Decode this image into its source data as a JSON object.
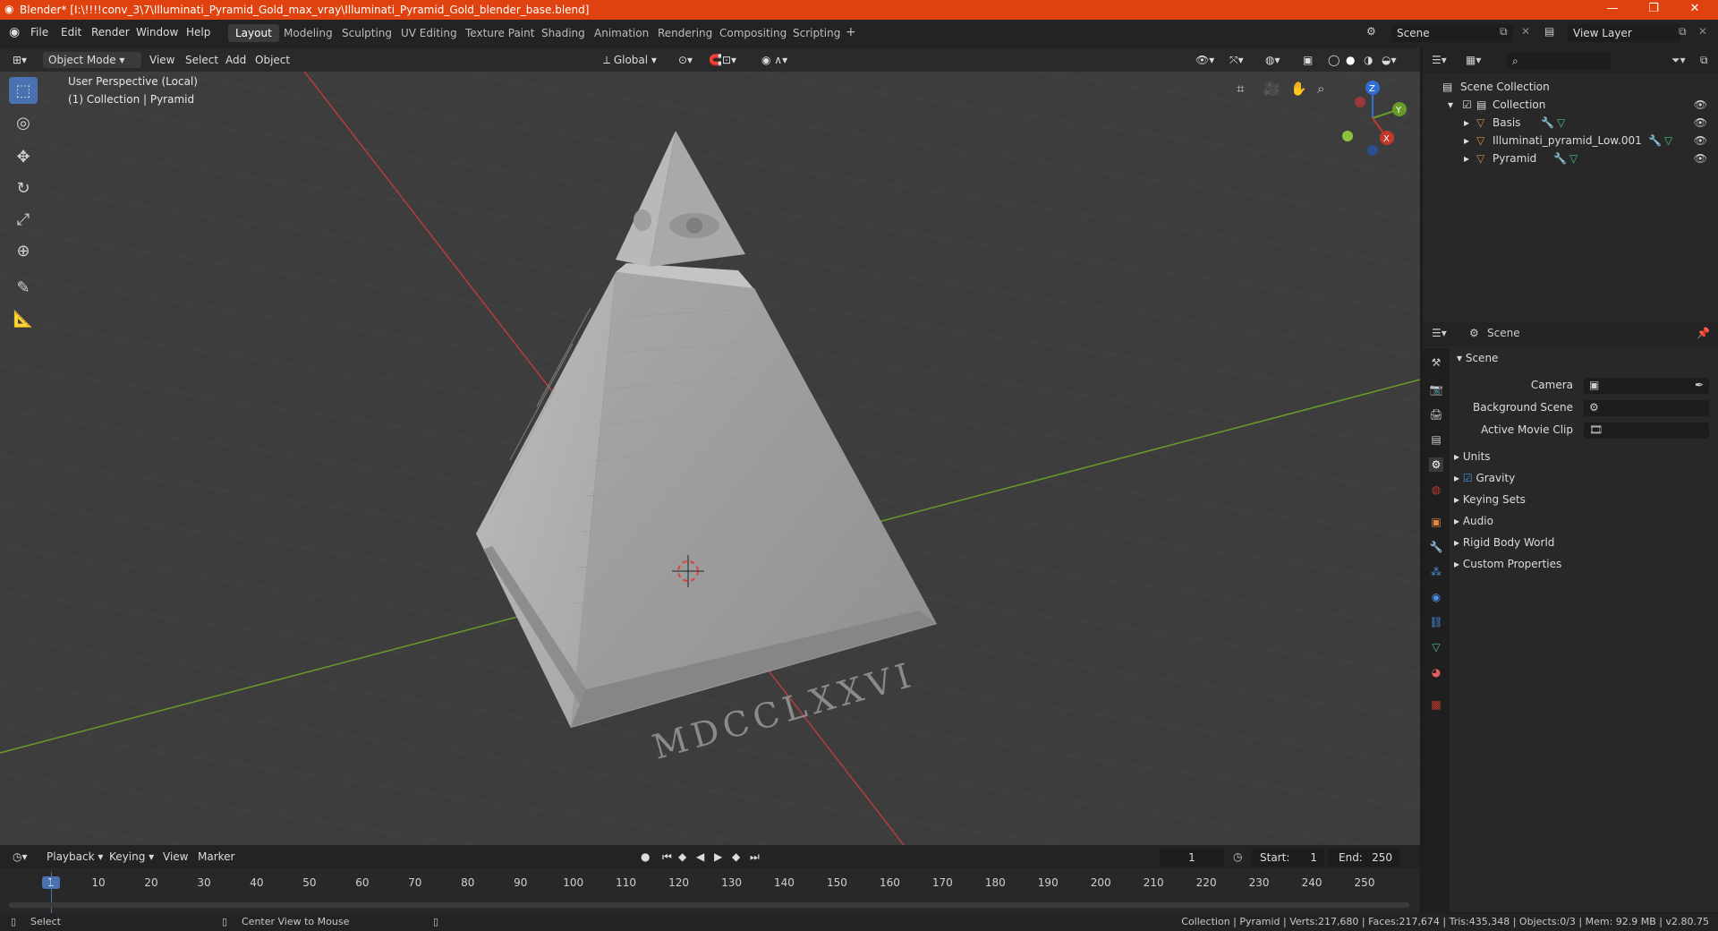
{
  "window": {
    "title": "Blender* [I:\\!!!!conv_3\\7\\Illuminati_Pyramid_Gold_max_vray\\Illuminati_Pyramid_Gold_blender_base.blend]",
    "minimize": "—",
    "maximize": "❐",
    "close": "✕"
  },
  "menu": [
    "File",
    "Edit",
    "Render",
    "Window",
    "Help"
  ],
  "workspaces": [
    "Layout",
    "Modeling",
    "Sculpting",
    "UV Editing",
    "Texture Paint",
    "Shading",
    "Animation",
    "Rendering",
    "Compositing",
    "Scripting"
  ],
  "scene_field": "Scene",
  "view_layer_field": "View Layer",
  "viewport": {
    "mode": "Object Mode",
    "header_menus": [
      "View",
      "Select",
      "Add",
      "Object"
    ],
    "orientation": "Global",
    "info_line1": "User Perspective (Local)",
    "info_line2": "(1) Collection | Pyramid",
    "inscription": "MDCCLXXVI",
    "gizmo_axes": [
      "Z",
      "Y",
      "X"
    ]
  },
  "outliner": {
    "root": "Scene Collection",
    "collection": "Collection",
    "items": [
      "Basis",
      "Illuminati_pyramid_Low.001",
      "Pyramid"
    ]
  },
  "properties": {
    "header": "Scene",
    "section": "Scene",
    "fields": [
      "Camera",
      "Background Scene",
      "Active Movie Clip"
    ],
    "subsections": [
      "Units",
      "Gravity",
      "Keying Sets",
      "Audio",
      "Rigid Body World",
      "Custom Properties"
    ]
  },
  "timeline": {
    "menus": [
      "Playback",
      "Keying",
      "View",
      "Marker"
    ],
    "current_frame": "1",
    "start_label": "Start:",
    "start": "1",
    "end_label": "End:",
    "end": "250",
    "ticks": [
      "1",
      "10",
      "20",
      "30",
      "40",
      "50",
      "60",
      "70",
      "80",
      "90",
      "100",
      "110",
      "120",
      "130",
      "140",
      "150",
      "160",
      "170",
      "180",
      "190",
      "200",
      "210",
      "220",
      "230",
      "240",
      "250"
    ]
  },
  "statusbar": {
    "left1": "Select",
    "left2": "Center View to Mouse",
    "right": "Collection | Pyramid | Verts:217,680 | Faces:217,674 | Tris:435,348 | Objects:0/3 | Mem: 92.9 MB | v2.80.75"
  },
  "colors": {
    "titlebar": "#e0420f",
    "accent": "#4a72b0",
    "x_axis": "#c0392b",
    "y_axis": "#6a9b2a",
    "z_axis": "#2f6fd6"
  }
}
